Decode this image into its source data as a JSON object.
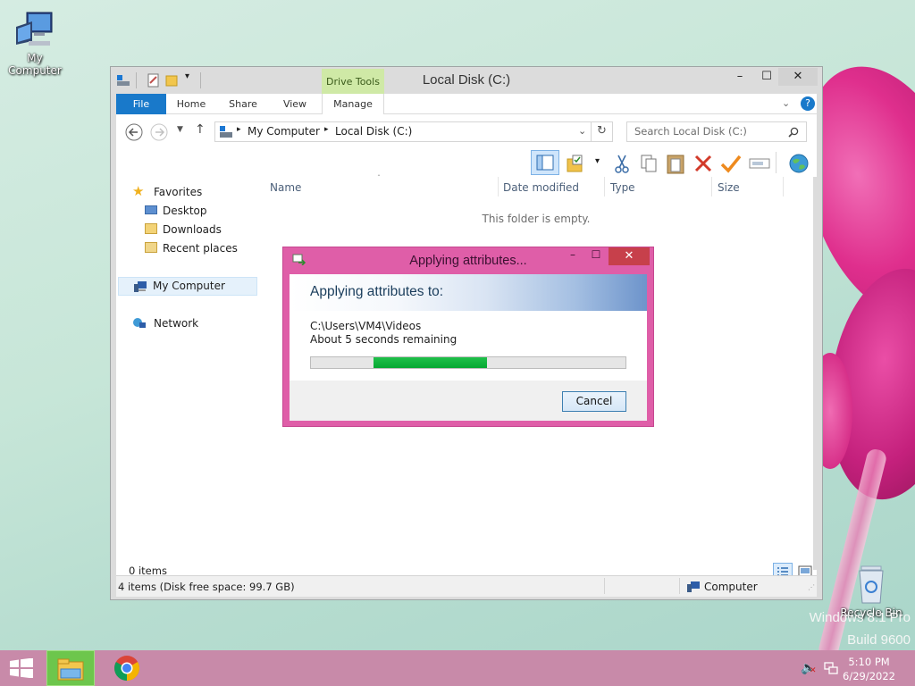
{
  "desktop": {
    "icons": [
      {
        "label": "My Computer",
        "icon": "computer-icon"
      },
      {
        "label": "Recycle Bin",
        "icon": "recycle-bin-icon"
      }
    ],
    "watermark_line1": "Windows 8.1 Pro",
    "watermark_line2": "Build 9600"
  },
  "window": {
    "title": "Local Disk (C:)",
    "contextual_tab_group": "Drive Tools",
    "tabs": [
      "File",
      "Home",
      "Share",
      "View",
      "Manage"
    ],
    "breadcrumb": [
      "My Computer",
      "Local Disk (C:)"
    ],
    "search_placeholder": "Search Local Disk (C:)",
    "nav": {
      "favorites_label": "Favorites",
      "favorites": [
        "Desktop",
        "Downloads",
        "Recent places"
      ],
      "computer": "My Computer",
      "network": "Network"
    },
    "columns": [
      "Name",
      "Date modified",
      "Type",
      "Size"
    ],
    "empty_message": "This folder is empty.",
    "item_count": "0 items",
    "info_left": "4 items (Disk free space: 99.7 GB)",
    "info_right": "Computer"
  },
  "dialog": {
    "title": "Applying attributes...",
    "header": "Applying attributes to:",
    "path": "C:\\Users\\VM4\\Videos",
    "remaining": "About 5 seconds remaining",
    "progress_fill_start": 0.2,
    "progress_fill_end": 0.56,
    "cancel_label": "Cancel"
  },
  "taskbar": {
    "time": "5:10 PM",
    "date": "6/29/2022"
  }
}
